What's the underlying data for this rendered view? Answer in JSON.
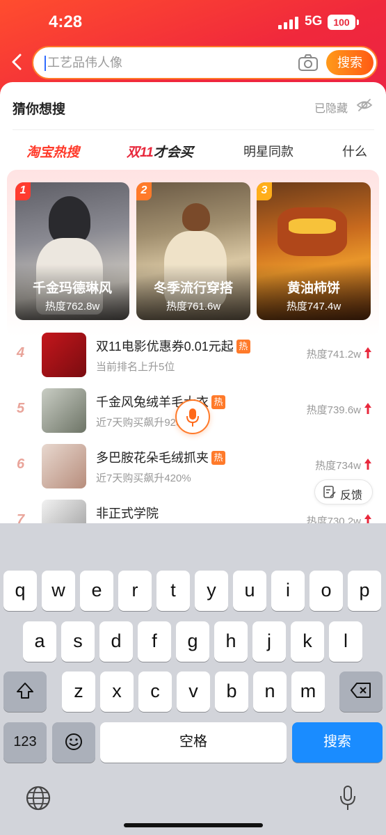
{
  "status_bar": {
    "time": "4:28",
    "network": "5G",
    "battery": "100"
  },
  "search": {
    "placeholder": "工艺品伟人像",
    "button_label": "搜索"
  },
  "guess": {
    "title": "猜你想搜",
    "hidden_label": "已隐藏"
  },
  "tabs": [
    {
      "label": "淘宝热搜"
    },
    {
      "label_a": "双11",
      "label_b": "才会买"
    },
    {
      "label": "明星同款"
    },
    {
      "label": "什么"
    }
  ],
  "top_cards": [
    {
      "rank": "1",
      "title": "千金玛德琳风",
      "heat": "热度762.8w"
    },
    {
      "rank": "2",
      "title": "冬季流行穿搭",
      "heat": "热度761.6w"
    },
    {
      "rank": "3",
      "title": "黄油柿饼",
      "heat": "热度747.4w"
    }
  ],
  "hot_list": [
    {
      "rank": "4",
      "title": "双11电影优惠券0.01元起",
      "tag": "热",
      "sub": "当前排名上升5位",
      "heat": "热度741.2w"
    },
    {
      "rank": "5",
      "title": "千金风兔绒羊毛大衣",
      "tag": "热",
      "sub": "近7天购买飙升925%",
      "heat": "热度739.6w"
    },
    {
      "rank": "6",
      "title": "多巴胺花朵毛绒抓夹",
      "tag": "热",
      "sub": "近7天购买飙升420%",
      "heat": "热度734w"
    },
    {
      "rank": "7",
      "title": "非正式学院",
      "tag": "",
      "sub": "",
      "heat": "热度730.2w"
    }
  ],
  "feedback_label": "反馈",
  "keyboard": {
    "row1": [
      "q",
      "w",
      "e",
      "r",
      "t",
      "y",
      "u",
      "i",
      "o",
      "p"
    ],
    "row2": [
      "a",
      "s",
      "d",
      "f",
      "g",
      "h",
      "j",
      "k",
      "l"
    ],
    "row3": [
      "z",
      "x",
      "c",
      "v",
      "b",
      "n",
      "m"
    ],
    "num_key": "123",
    "space_key": "空格",
    "search_key": "搜索"
  },
  "colors": {
    "accent": "#ff5a14",
    "brand_red": "#e8283c",
    "key_blue": "#1a8cff"
  }
}
